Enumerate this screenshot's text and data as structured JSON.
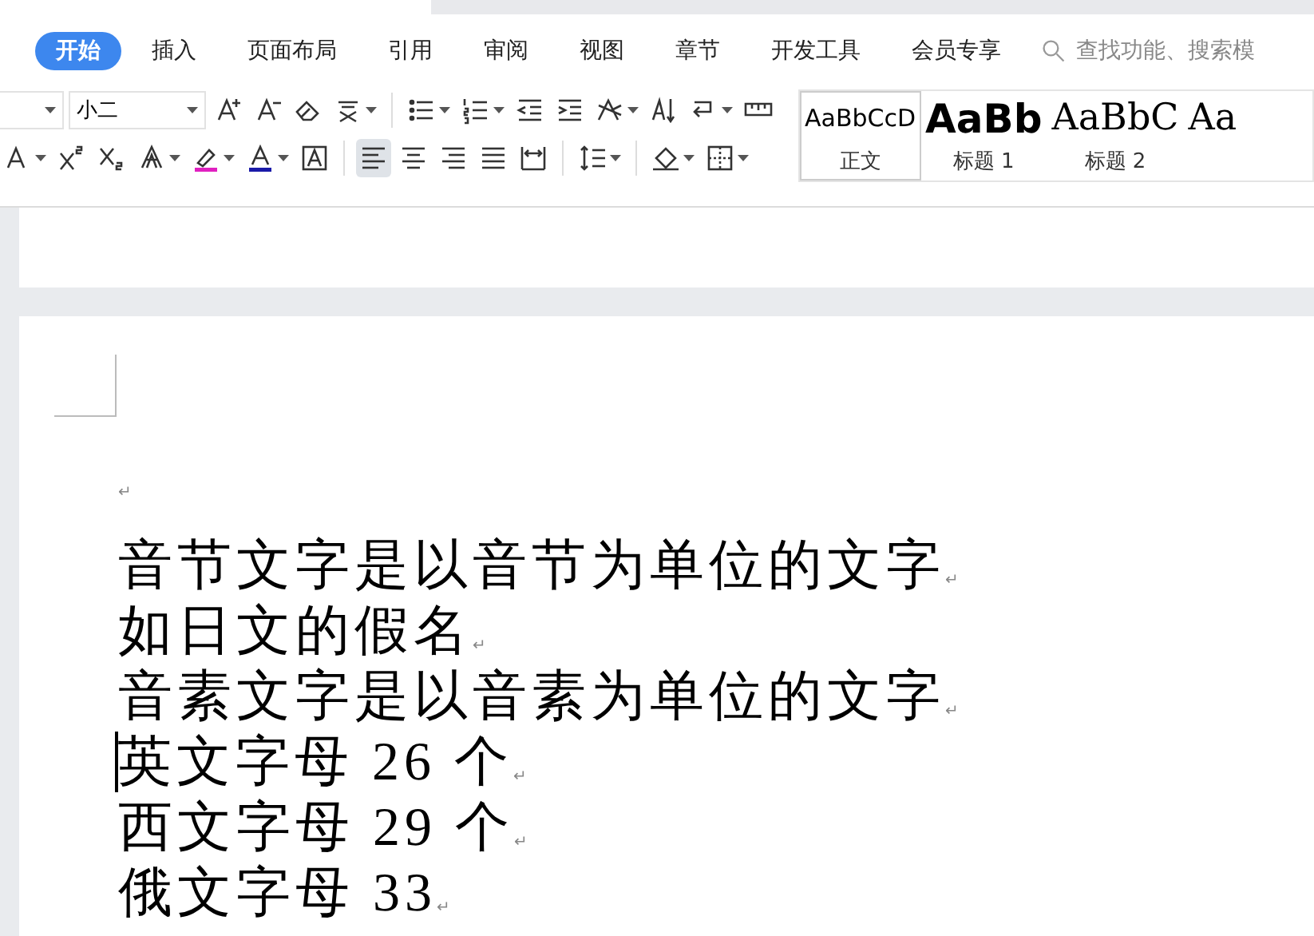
{
  "tabs": [
    {
      "label": "开始",
      "selected": true
    },
    {
      "label": "插入",
      "selected": false
    },
    {
      "label": "页面布局",
      "selected": false
    },
    {
      "label": "引用",
      "selected": false
    },
    {
      "label": "审阅",
      "selected": false
    },
    {
      "label": "视图",
      "selected": false
    },
    {
      "label": "章节",
      "selected": false
    },
    {
      "label": "开发工具",
      "selected": false
    },
    {
      "label": "会员专享",
      "selected": false
    }
  ],
  "search": {
    "placeholder": "查找功能、搜索模"
  },
  "font_size": {
    "value": "小二"
  },
  "toolbar_row_1": [
    {
      "kind": "grow",
      "dropdown": false
    },
    {
      "kind": "shrink",
      "dropdown": false
    },
    {
      "kind": "eraser",
      "dropdown": false
    },
    {
      "kind": "pinyin",
      "dropdown": true
    },
    {
      "kind": "sep"
    },
    {
      "kind": "bullets",
      "dropdown": true
    },
    {
      "kind": "numbering",
      "dropdown": true
    },
    {
      "kind": "outdent",
      "dropdown": false
    },
    {
      "kind": "indent",
      "dropdown": false
    },
    {
      "kind": "layout",
      "dropdown": true
    },
    {
      "kind": "sort",
      "dropdown": false
    },
    {
      "kind": "marks",
      "dropdown": true
    },
    {
      "kind": "ruler",
      "dropdown": false
    }
  ],
  "toolbar_row_2": [
    {
      "kind": "underline",
      "dropdown": true
    },
    {
      "kind": "superscript",
      "dropdown": false
    },
    {
      "kind": "subscript",
      "dropdown": false
    },
    {
      "kind": "effect",
      "dropdown": true
    },
    {
      "kind": "highlight",
      "dropdown": true
    },
    {
      "kind": "fontcolor",
      "dropdown": true
    },
    {
      "kind": "charborder",
      "dropdown": false
    },
    {
      "kind": "sep"
    },
    {
      "kind": "align-left",
      "dropdown": false,
      "selected": true
    },
    {
      "kind": "align-center",
      "dropdown": false,
      "selected": false
    },
    {
      "kind": "align-right",
      "dropdown": false,
      "selected": false
    },
    {
      "kind": "justify",
      "dropdown": false,
      "selected": false
    },
    {
      "kind": "distribute",
      "dropdown": false,
      "selected": false
    },
    {
      "kind": "sep"
    },
    {
      "kind": "linespacing",
      "dropdown": true
    },
    {
      "kind": "sep"
    },
    {
      "kind": "shading",
      "dropdown": true
    },
    {
      "kind": "borders",
      "dropdown": true
    }
  ],
  "styles": [
    {
      "sample": "AaBbCcD",
      "label": "正文",
      "kind": "body",
      "selected": true
    },
    {
      "sample": "AaBb",
      "label": "标题 1",
      "kind": "h1",
      "selected": false
    },
    {
      "sample": "AaBbC",
      "label": "标题 2",
      "kind": "h2",
      "selected": false
    },
    {
      "sample": "Aa",
      "kind": "h3",
      "selected": false
    }
  ],
  "document": {
    "lines": [
      {
        "mark": "↵",
        "cursor": false,
        "kind": "small"
      },
      {
        "text": "音节文字是以音节为单位的文字",
        "mark": "↵",
        "cursor": false,
        "kind": "body"
      },
      {
        "text": "如日文的假名",
        "mark": "↵",
        "cursor": false,
        "kind": "body"
      },
      {
        "text": "音素文字是以音素为单位的文字",
        "mark": "↵",
        "cursor": false,
        "kind": "body"
      },
      {
        "text": "英文字母 26 个",
        "mark": "↵",
        "cursor": true,
        "kind": "body"
      },
      {
        "text": "西文字母 29 个",
        "mark": "↵",
        "cursor": false,
        "kind": "body"
      },
      {
        "text": "俄文字母 33",
        "mark": "↵",
        "cursor": false,
        "kind": "body"
      }
    ]
  }
}
